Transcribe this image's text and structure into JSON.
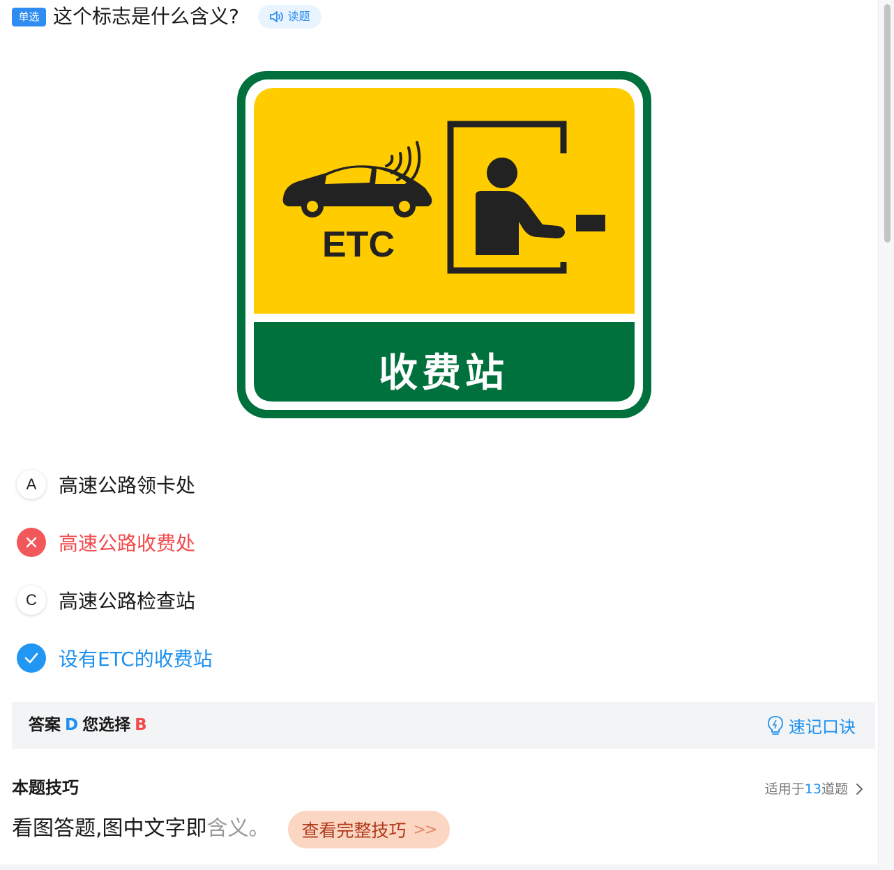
{
  "header": {
    "tag": "单选",
    "question": "这个标志是什么含义?",
    "read_label": "读题",
    "read_icon": "speaker-icon"
  },
  "sign": {
    "top_text": "ETC",
    "bottom_text": "收费站",
    "colors": {
      "border": "#00703c",
      "yellow": "#ffcc00",
      "green": "#00703c",
      "icon": "#222222"
    }
  },
  "options": [
    {
      "marker": "A",
      "text": "高速公路领卡处",
      "state": "normal"
    },
    {
      "marker": "",
      "text": "高速公路收费处",
      "state": "wrong",
      "icon": "close-icon"
    },
    {
      "marker": "C",
      "text": "高速公路检查站",
      "state": "normal"
    },
    {
      "marker": "",
      "text": "设有ETC的收费站",
      "state": "correct",
      "icon": "check-icon"
    }
  ],
  "answer": {
    "label": "答案",
    "correct": "D",
    "your_label": "您选择",
    "your_choice": "B",
    "mnemonic_label": "速记口诀",
    "mnemonic_icon": "lightbulb-icon"
  },
  "tips": {
    "title": "本题技巧",
    "applies_prefix": "适用于",
    "applies_count": "13",
    "applies_suffix": "道题",
    "text_main": "看图答题,图中文字即",
    "text_fade": "含义。",
    "button": "查看完整技巧",
    "button_arrows": ">>"
  },
  "colors": {
    "accent": "#1e90ef",
    "wrong": "#f24a4c",
    "tip_button_bg": "#fbd6c3"
  }
}
